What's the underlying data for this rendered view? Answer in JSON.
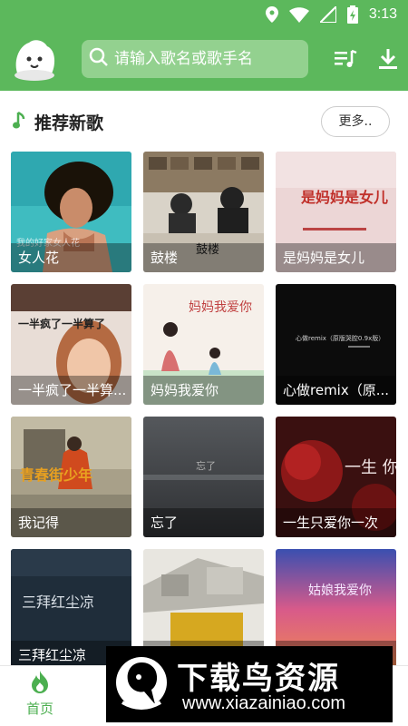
{
  "status_bar": {
    "time": "3:13"
  },
  "header": {
    "search_placeholder": "请输入歌名或歌手名"
  },
  "section": {
    "title": "推荐新歌",
    "more_label": "更多.."
  },
  "songs": [
    {
      "title": "女人花"
    },
    {
      "title": "鼓楼"
    },
    {
      "title": "是妈妈是女儿"
    },
    {
      "title": "一半疯了一半算..."
    },
    {
      "title": "妈妈我爱你"
    },
    {
      "title": "心做remix（原..."
    },
    {
      "title": "我记得"
    },
    {
      "title": "忘了"
    },
    {
      "title": "一生只爱你一次"
    },
    {
      "title": "三拜红尘凉"
    },
    {
      "title": ""
    },
    {
      "title": ""
    }
  ],
  "cover_art_text": {
    "c1": "我的好家女人花",
    "c2": "鼓楼",
    "c3": "是妈妈是女儿",
    "c4": "一半疯了一半算了",
    "c5": "妈妈我爱你",
    "c6": "心做remix（原版哭腔0.9x版）",
    "c7": "青春街少年",
    "c8": "忘了",
    "c9": "一生 你",
    "c10": "三拜红尘凉",
    "c12": "姑娘我爱你"
  },
  "bottom_nav": {
    "home_label": "首页"
  },
  "watermark": {
    "title": "下载鸟资源",
    "url": "www.xiazainiao.com"
  },
  "colors": {
    "primary": "#5cb85c",
    "search_bg": "#93d18f",
    "active_nav": "#4caf50"
  },
  "icons": [
    "location-icon",
    "wifi-icon",
    "signal-icon",
    "battery-icon",
    "search-icon",
    "playlist-icon",
    "download-icon",
    "music-note-icon",
    "home-flame-icon"
  ]
}
